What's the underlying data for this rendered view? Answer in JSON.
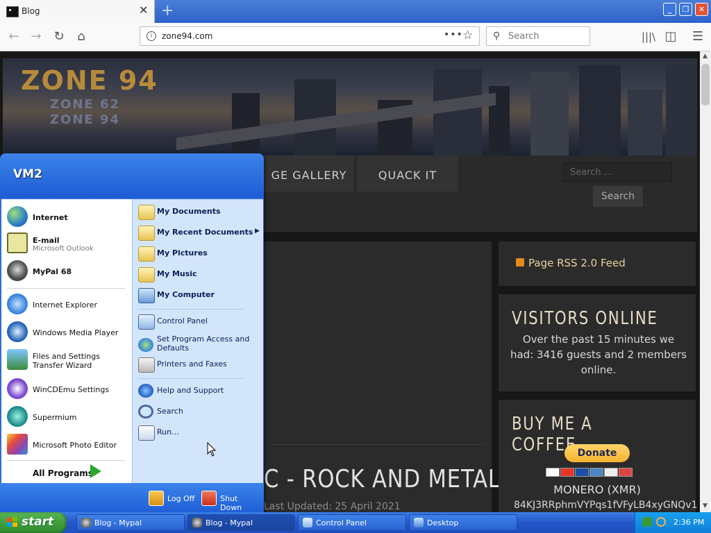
{
  "browser": {
    "tab_title": "Blog",
    "tab_close": "✕",
    "new_tab": "+",
    "url": "zone94.com",
    "search_placeholder": "Search",
    "min": "_",
    "max": "❐",
    "close": "✕"
  },
  "site": {
    "logo_main": "ZONE 94",
    "logo_sub1": "ZONE 62",
    "logo_sub2": "ZONE 94",
    "menu": [
      "GE GALLERY",
      "QUACK IT"
    ],
    "search_placeholder": "Search ...",
    "search_button": "Search",
    "headline": "C - ROCK AND METAL",
    "updated": "Last Updated: 25 April 2021",
    "rss": "Page RSS 2.0 Feed",
    "visitors_title": "VISITORS ONLINE",
    "visitors_text": "Over the past 15 minutes we had: 3416 guests and 2 members online.",
    "coffee_title": "BUY ME A COFFEE",
    "donate": "Donate",
    "monero": "MONERO (XMR)",
    "address": "84KJ3RRphmVYPqs1fVFyLB4xyGNQv1"
  },
  "startmenu": {
    "user": "VM2",
    "pinned": [
      {
        "label": "Internet",
        "sub": ""
      },
      {
        "label": "E-mail",
        "sub": "Microsoft Outlook"
      },
      {
        "label": "MyPal 68",
        "sub": ""
      }
    ],
    "recent": [
      "Internet Explorer",
      "Windows Media Player",
      "Files and Settings Transfer Wizard",
      "WinCDEmu Settings",
      "Supermium",
      "Microsoft Photo Editor"
    ],
    "all_programs": "All Programs",
    "places": [
      "My Documents",
      "My Recent Documents",
      "My Pictures",
      "My Music",
      "My Computer"
    ],
    "system": [
      "Control Panel",
      "Set Program Access and Defaults",
      "Printers and Faxes"
    ],
    "tools": [
      "Help and Support",
      "Search",
      "Run..."
    ],
    "logoff": "Log Off",
    "shutdown": "Shut Down"
  },
  "taskbar": {
    "start": "start",
    "tasks": [
      "Blog - Mypal",
      "Blog - Mypal",
      "Control Panel",
      "Desktop"
    ],
    "time": "2:36 PM"
  },
  "colors": {
    "xp_blue": "#2f6ad7",
    "start_green": "#3c9a38",
    "page_bg": "#171717"
  }
}
